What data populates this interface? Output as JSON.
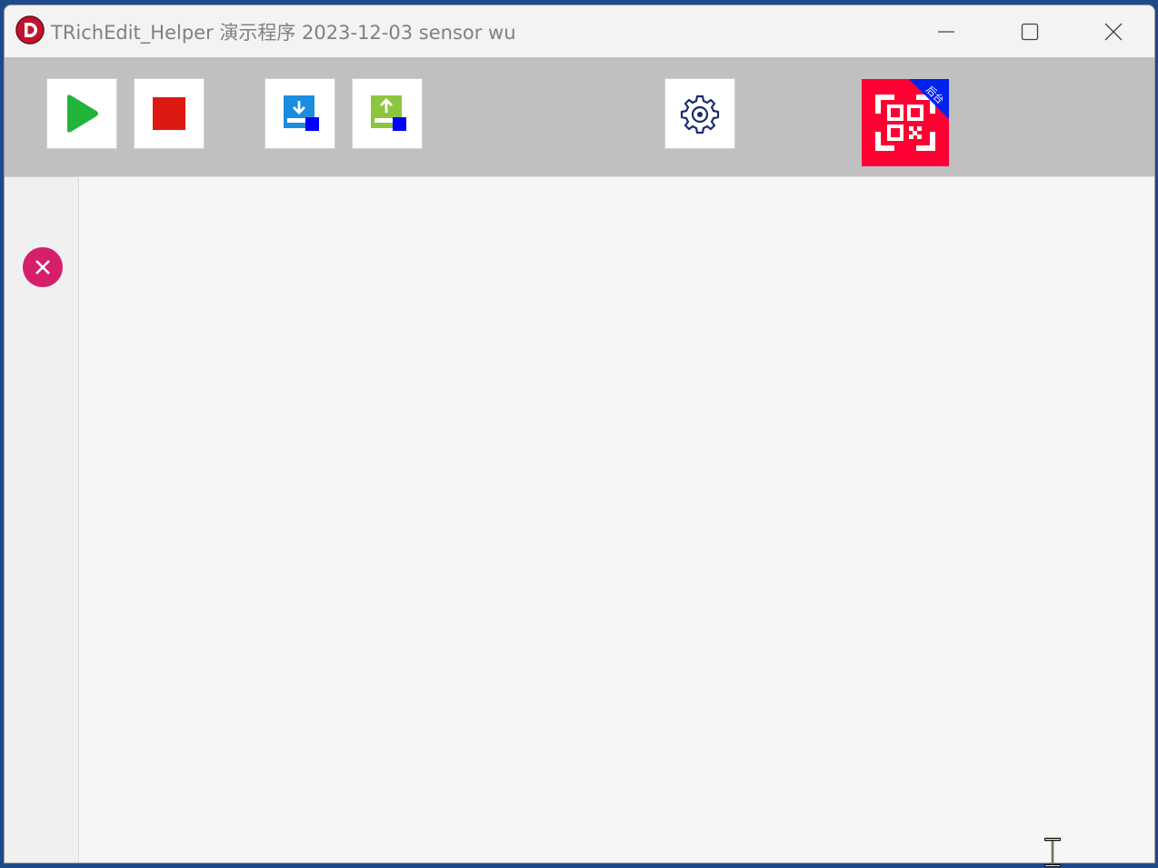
{
  "window": {
    "title": "TRichEdit_Helper 演示程序 2023-12-03 sensor wu",
    "app_icon": "delphi-logo-icon",
    "caption_buttons": [
      "minimize-icon",
      "maximize-icon",
      "close-icon"
    ]
  },
  "toolbar": {
    "buttons": [
      {
        "name": "run-button",
        "icon": "play-icon",
        "color": "#22b33a"
      },
      {
        "name": "stop-button",
        "icon": "stop-icon",
        "color": "#dd1a12"
      },
      {
        "name": "import-button",
        "icon": "download-icon",
        "color": "#1a8de0"
      },
      {
        "name": "export-button",
        "icon": "upload-icon",
        "color": "#8cc63f"
      },
      {
        "name": "settings-button",
        "icon": "gear-icon",
        "color": "#1a2a6c"
      }
    ],
    "qr_button": {
      "icon": "qr-scan-icon",
      "background": "#ff0033",
      "ribbon_color": "#0022ee",
      "ribbon_text": "后台"
    }
  },
  "sidebar": {
    "close_icon_color": "#d61f6b"
  },
  "colors": {
    "toolbar_bg": "#c0c0c0",
    "editor_bg": "#f6f6f6",
    "title_text": "#808080"
  }
}
